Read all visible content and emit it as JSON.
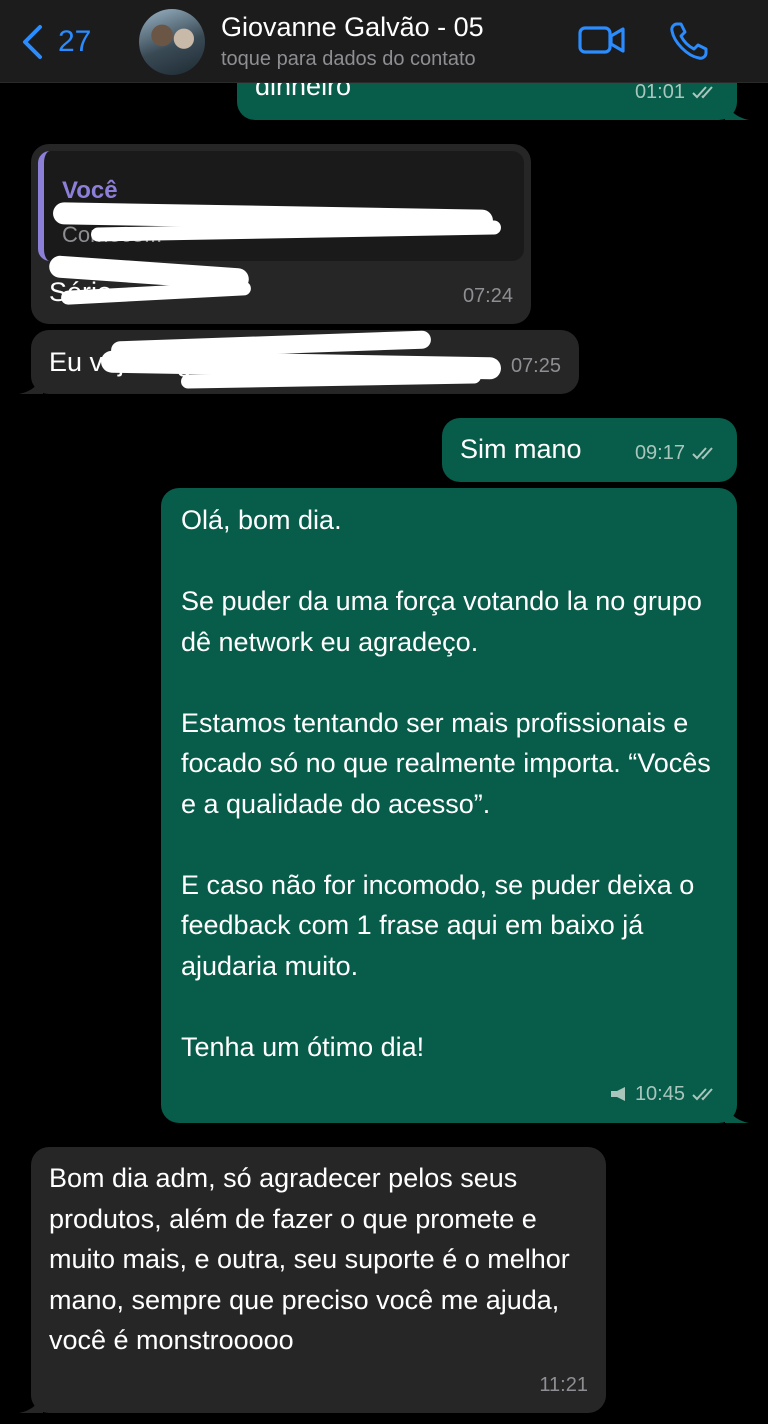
{
  "header": {
    "back_count": "27",
    "contact_name": "Giovanne Galvão - 05",
    "contact_subtitle": "toque para dados do contato"
  },
  "messages": [
    {
      "text": "dinheiro",
      "time": "01:01"
    },
    {
      "quote_author": "Você",
      "quote_text": "Comece...",
      "text": "Sério...",
      "time": "07:24"
    },
    {
      "text": "Eu vejo ... grupo ...",
      "time": "07:25"
    },
    {
      "text": "Sim mano",
      "time": "09:17"
    },
    {
      "text": "Olá, bom dia.\n\nSe puder da uma força votando la no grupo dê network eu agradeço.\n\nEstamos tentando ser mais profissionais e focado só no que realmente importa. “Vocês e a qualidade do acesso”.\n\nE caso não for incomodo, se puder deixa o feedback com 1 frase aqui em baixo já ajudaria muito.\n\nTenha um ótimo dia!",
      "time": "10:45"
    },
    {
      "text": "Bom dia adm, só agradecer pelos seus produtos, além de fazer o que promete e muito mais, e outra, seu suporte é o melhor mano, sempre que preciso você me ajuda, você é monstrooooo",
      "time": "11:21"
    }
  ],
  "colors": {
    "background": "#000000",
    "header": "#1c1c1c",
    "outgoing_bubble": "#075c4a",
    "incoming_bubble": "#262626",
    "accent": "#2b8cff",
    "quote_author": "#8b7fd8"
  },
  "icons": [
    "chevron-left-icon",
    "video-camera-icon",
    "phone-icon",
    "double-check-icon",
    "megaphone-icon"
  ]
}
